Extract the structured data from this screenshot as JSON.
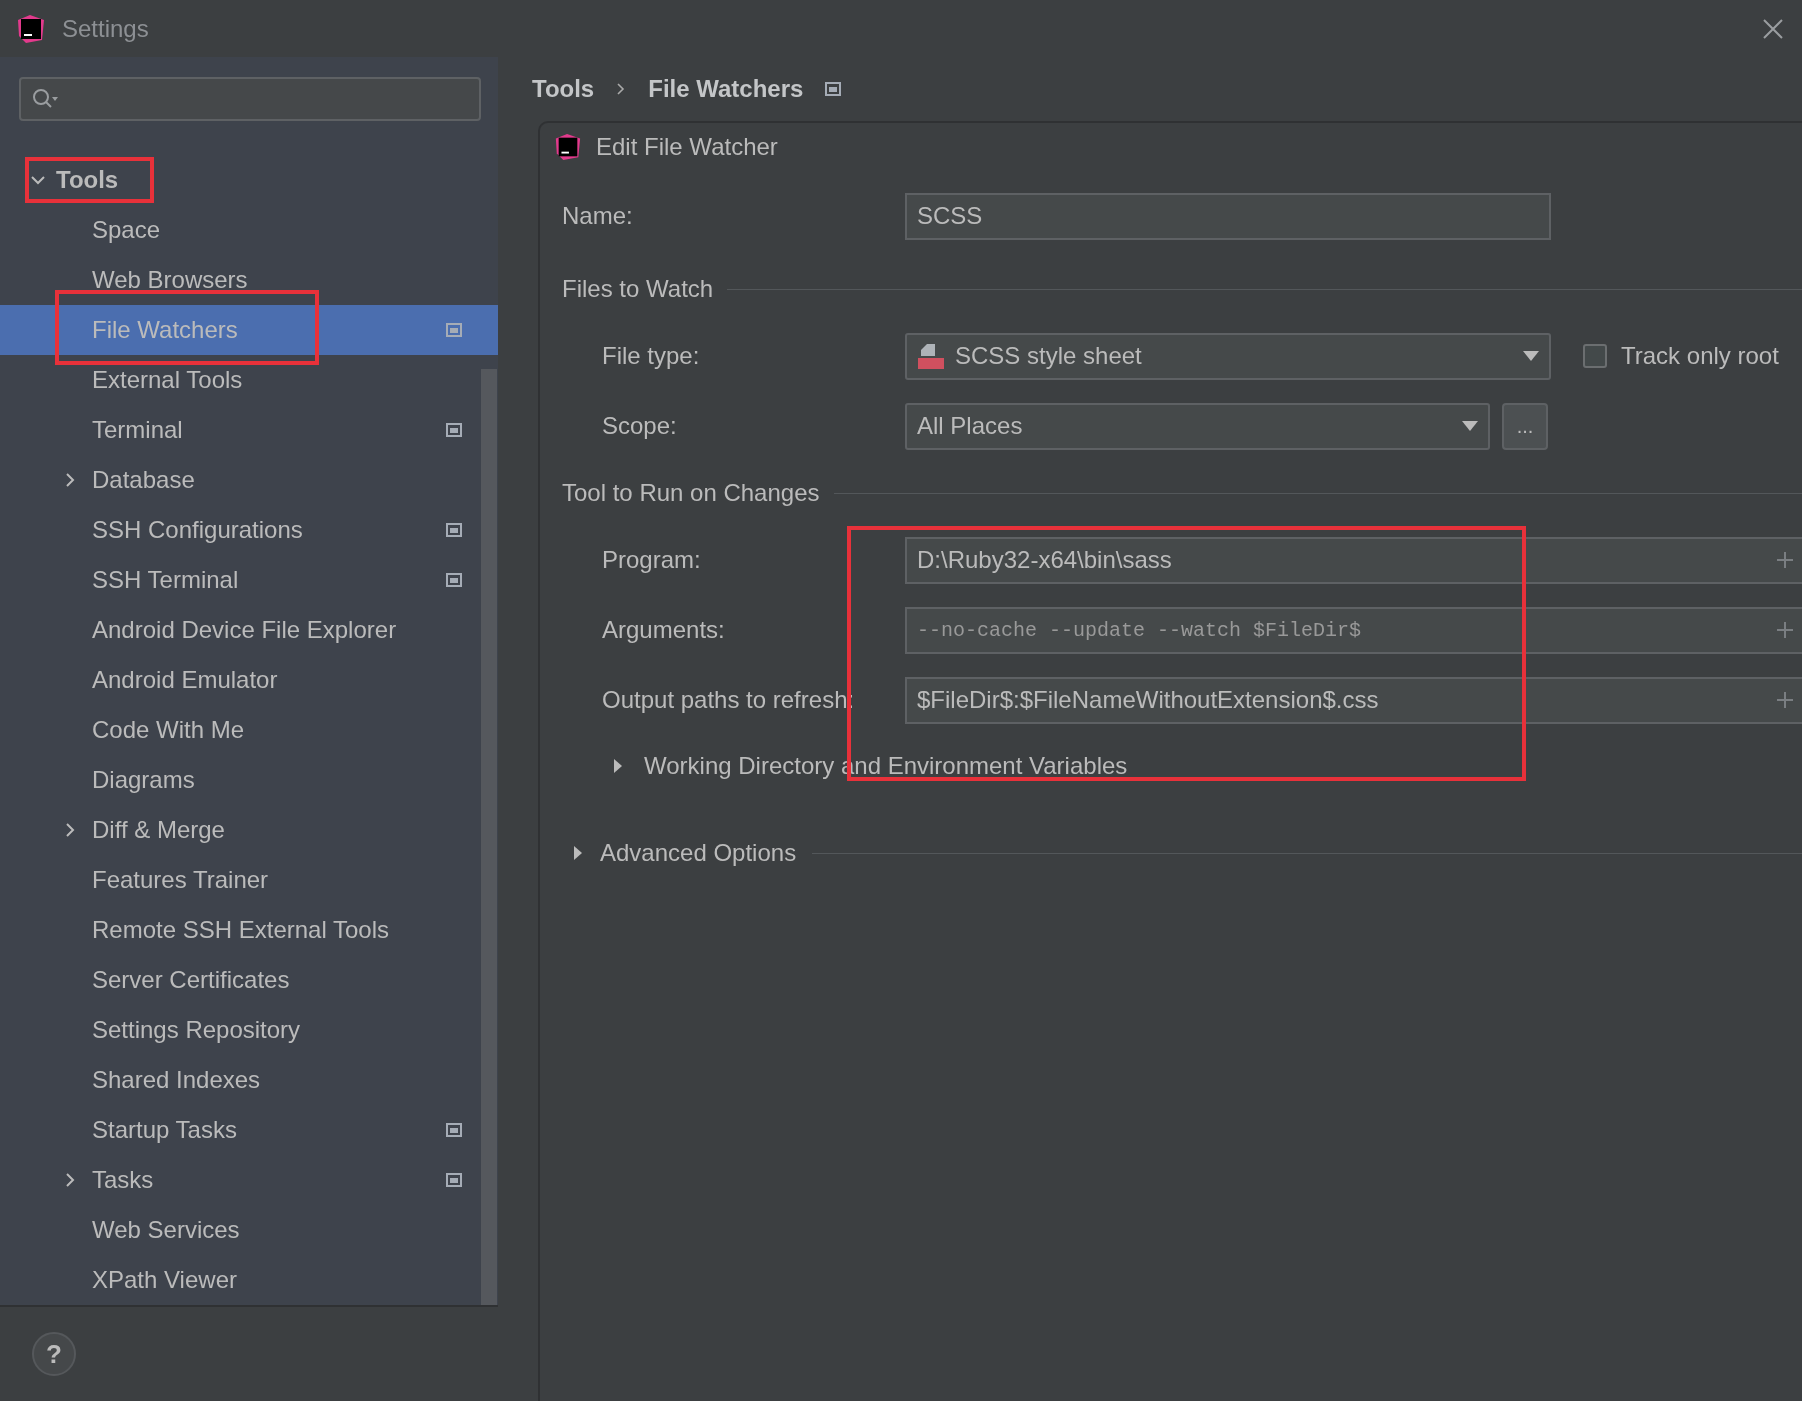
{
  "window": {
    "title": "Settings"
  },
  "tree": [
    {
      "label": "Tools",
      "expanded": true,
      "selected": false,
      "children": [
        {
          "label": "Space",
          "selected": false,
          "scope_icon": false
        },
        {
          "label": "Web Browsers",
          "selected": false,
          "scope_icon": false
        },
        {
          "label": "File Watchers",
          "selected": true,
          "scope_icon": true
        },
        {
          "label": "External Tools",
          "selected": false,
          "scope_icon": false
        },
        {
          "label": "Terminal",
          "selected": false,
          "scope_icon": true
        },
        {
          "label": "Database",
          "selected": false,
          "scope_icon": false,
          "expanded": false
        },
        {
          "label": "SSH Configurations",
          "selected": false,
          "scope_icon": true
        },
        {
          "label": "SSH Terminal",
          "selected": false,
          "scope_icon": true
        },
        {
          "label": "Android Device File Explorer",
          "selected": false,
          "scope_icon": false
        },
        {
          "label": "Android Emulator",
          "selected": false,
          "scope_icon": false
        },
        {
          "label": "Code With Me",
          "selected": false,
          "scope_icon": false
        },
        {
          "label": "Diagrams",
          "selected": false,
          "scope_icon": false
        },
        {
          "label": "Diff & Merge",
          "selected": false,
          "scope_icon": false,
          "expanded": false
        },
        {
          "label": "Features Trainer",
          "selected": false,
          "scope_icon": false
        },
        {
          "label": "Remote SSH External Tools",
          "selected": false,
          "scope_icon": false
        },
        {
          "label": "Server Certificates",
          "selected": false,
          "scope_icon": false
        },
        {
          "label": "Settings Repository",
          "selected": false,
          "scope_icon": false
        },
        {
          "label": "Shared Indexes",
          "selected": false,
          "scope_icon": false
        },
        {
          "label": "Startup Tasks",
          "selected": false,
          "scope_icon": true
        },
        {
          "label": "Tasks",
          "selected": false,
          "scope_icon": true,
          "expanded": false
        },
        {
          "label": "Web Services",
          "selected": false,
          "scope_icon": false
        },
        {
          "label": "XPath Viewer",
          "selected": false,
          "scope_icon": false
        }
      ]
    }
  ],
  "breadcrumb": [
    "Tools",
    "File Watchers"
  ],
  "dialog": {
    "title": "Edit File Watcher",
    "name": {
      "label": "Name:",
      "value": "SCSS"
    },
    "sections": [
      {
        "kind": "group",
        "title": "Files to Watch",
        "rows": [
          {
            "kind": "dropdown",
            "label": "File type:",
            "value": "SCSS style sheet",
            "file_icon": true,
            "checkbox": {
              "label": "Track only root",
              "checked": false
            }
          },
          {
            "kind": "dropdown",
            "label": "Scope:",
            "value": "All Places",
            "browse": "..."
          }
        ]
      },
      {
        "kind": "group",
        "title": "Tool to Run on Changes",
        "rows": [
          {
            "kind": "text",
            "label": "Program:",
            "value": "D:\\Ruby32-x64\\bin\\sass"
          },
          {
            "kind": "mono",
            "label": "Arguments:",
            "value": "--no-cache --update --watch $FileDir$"
          },
          {
            "kind": "text",
            "label": "Output paths to refresh:",
            "value": "$FileDir$:$FileNameWithoutExtension$.css"
          },
          {
            "kind": "expander",
            "label": "Working Directory and Environment Variables",
            "expanded": false
          }
        ]
      },
      {
        "kind": "collapsible",
        "title": "Advanced Options",
        "expanded": false
      }
    ]
  },
  "help": "?"
}
